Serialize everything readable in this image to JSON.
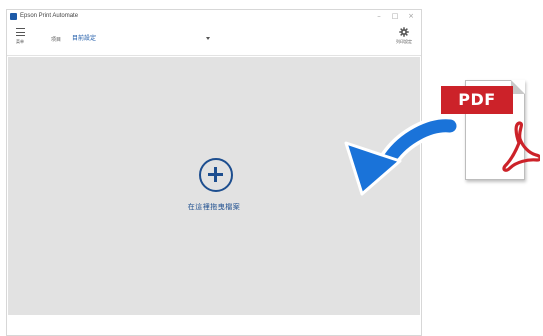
{
  "window": {
    "title": "Epson Print Automate",
    "controls": {
      "minimize": "–",
      "maximize": "□",
      "close": "×"
    }
  },
  "toolbar": {
    "menu_label": "菜单",
    "settings_field_label": "项目",
    "settings_value": "目前設定",
    "print_settings_label": "列印設定"
  },
  "drop_zone": {
    "hint": "在這裡拖曳檔案",
    "background": "#e2e2e2",
    "accent": "#1d4e8f"
  },
  "overlay": {
    "file_badge": "PDF",
    "badge_color": "#cc2229",
    "arrow_color": "#1a73d9",
    "icons": [
      "plus-circle-icon",
      "drag-arrow-icon",
      "pdf-file-icon",
      "acrobat-logo-icon"
    ]
  }
}
